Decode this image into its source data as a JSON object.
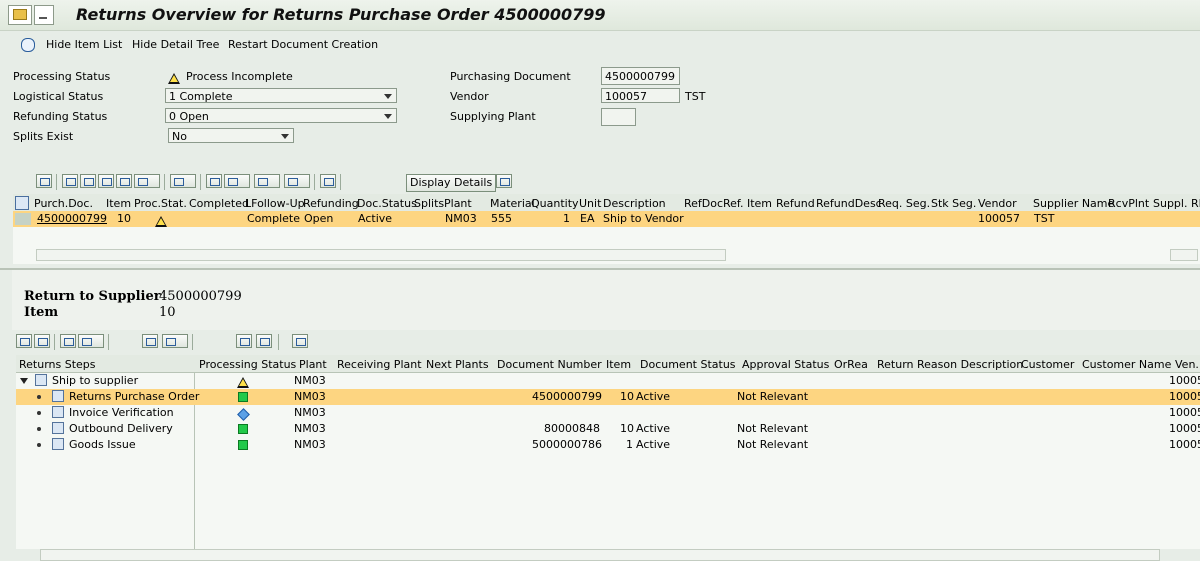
{
  "window": {
    "title": "Returns Overview for Returns Purchase Order 4500000799"
  },
  "app_toolbar": {
    "hide_item_list": "Hide Item List",
    "hide_detail_tree": "Hide Detail Tree",
    "restart": "Restart Document Creation"
  },
  "header_form": {
    "processing_status_label": "Processing Status",
    "processing_status_value": "Process Incomplete",
    "logistical_status_label": "Logistical Status",
    "logistical_status_value": "1 Complete",
    "refunding_status_label": "Refunding Status",
    "refunding_status_value": "0 Open",
    "splits_exist_label": "Splits Exist",
    "splits_exist_value": "No",
    "purchasing_document_label": "Purchasing Document",
    "purchasing_document_value": "4500000799",
    "vendor_label": "Vendor",
    "vendor_value": "100057",
    "vendor_name": "TST",
    "supplying_plant_label": "Supplying Plant",
    "supplying_plant_value": ""
  },
  "item_grid": {
    "display_details": "Display Details",
    "columns": [
      "Purch.Doc.",
      "Item",
      "Proc.Stat.",
      "Completed",
      "LFollow-Up",
      "Refunding",
      "Doc.Status",
      "Splits",
      "Plant",
      "Material",
      "Quantity",
      "Unit",
      "Description",
      "RefDoc",
      "Ref. Item",
      "Refund",
      "RefundDesc",
      "Req. Seg.",
      "Stk Seg.",
      "Vendor",
      "Supplier Name",
      "RcvPlnt",
      "Suppl. RMA"
    ],
    "row": {
      "purch_doc": "4500000799",
      "item": "10",
      "completed": "Complete",
      "lfollow_up": "Open",
      "refunding": "Active",
      "plant": "NM03",
      "material": "555",
      "quantity": "1",
      "unit": "EA",
      "description": "Ship to Vendor",
      "vendor": "100057",
      "supplier_name": "TST"
    }
  },
  "detail": {
    "return_label": "Return to Supplier",
    "return_value": "4500000799",
    "item_label": "Item",
    "item_value": "10"
  },
  "tree_grid": {
    "columns": [
      "Returns Steps",
      "Processing Status",
      "Plant",
      "Receiving Plant",
      "Next Plants",
      "Document Number",
      "Item",
      "Document Status",
      "Approval Status",
      "OrRea",
      "Return Reason Description",
      "Customer",
      "Customer Name",
      "Ven."
    ],
    "rows": [
      {
        "step": "Ship to supplier",
        "plant": "NM03",
        "doc": "",
        "item": "",
        "status": "",
        "approval": "",
        "vendor": "10005"
      },
      {
        "step": "Returns Purchase Order",
        "plant": "NM03",
        "doc": "4500000799",
        "item": "10",
        "status": "Active",
        "approval": "Not Relevant",
        "vendor": "10005"
      },
      {
        "step": "Invoice Verification",
        "plant": "NM03",
        "doc": "",
        "item": "",
        "status": "",
        "approval": "",
        "vendor": "10005"
      },
      {
        "step": "Outbound Delivery",
        "plant": "NM03",
        "doc": "80000848",
        "item": "10",
        "status": "Active",
        "approval": "Not Relevant",
        "vendor": "10005"
      },
      {
        "step": "Goods Issue",
        "plant": "NM03",
        "doc": "5000000786",
        "item": "1",
        "status": "Active",
        "approval": "Not Relevant",
        "vendor": "10005"
      }
    ]
  },
  "colors": {
    "highlight": "#fdd581",
    "background": "#e7ede7",
    "status_green": "#22c94a",
    "warning_yellow": "#ffe14a"
  }
}
